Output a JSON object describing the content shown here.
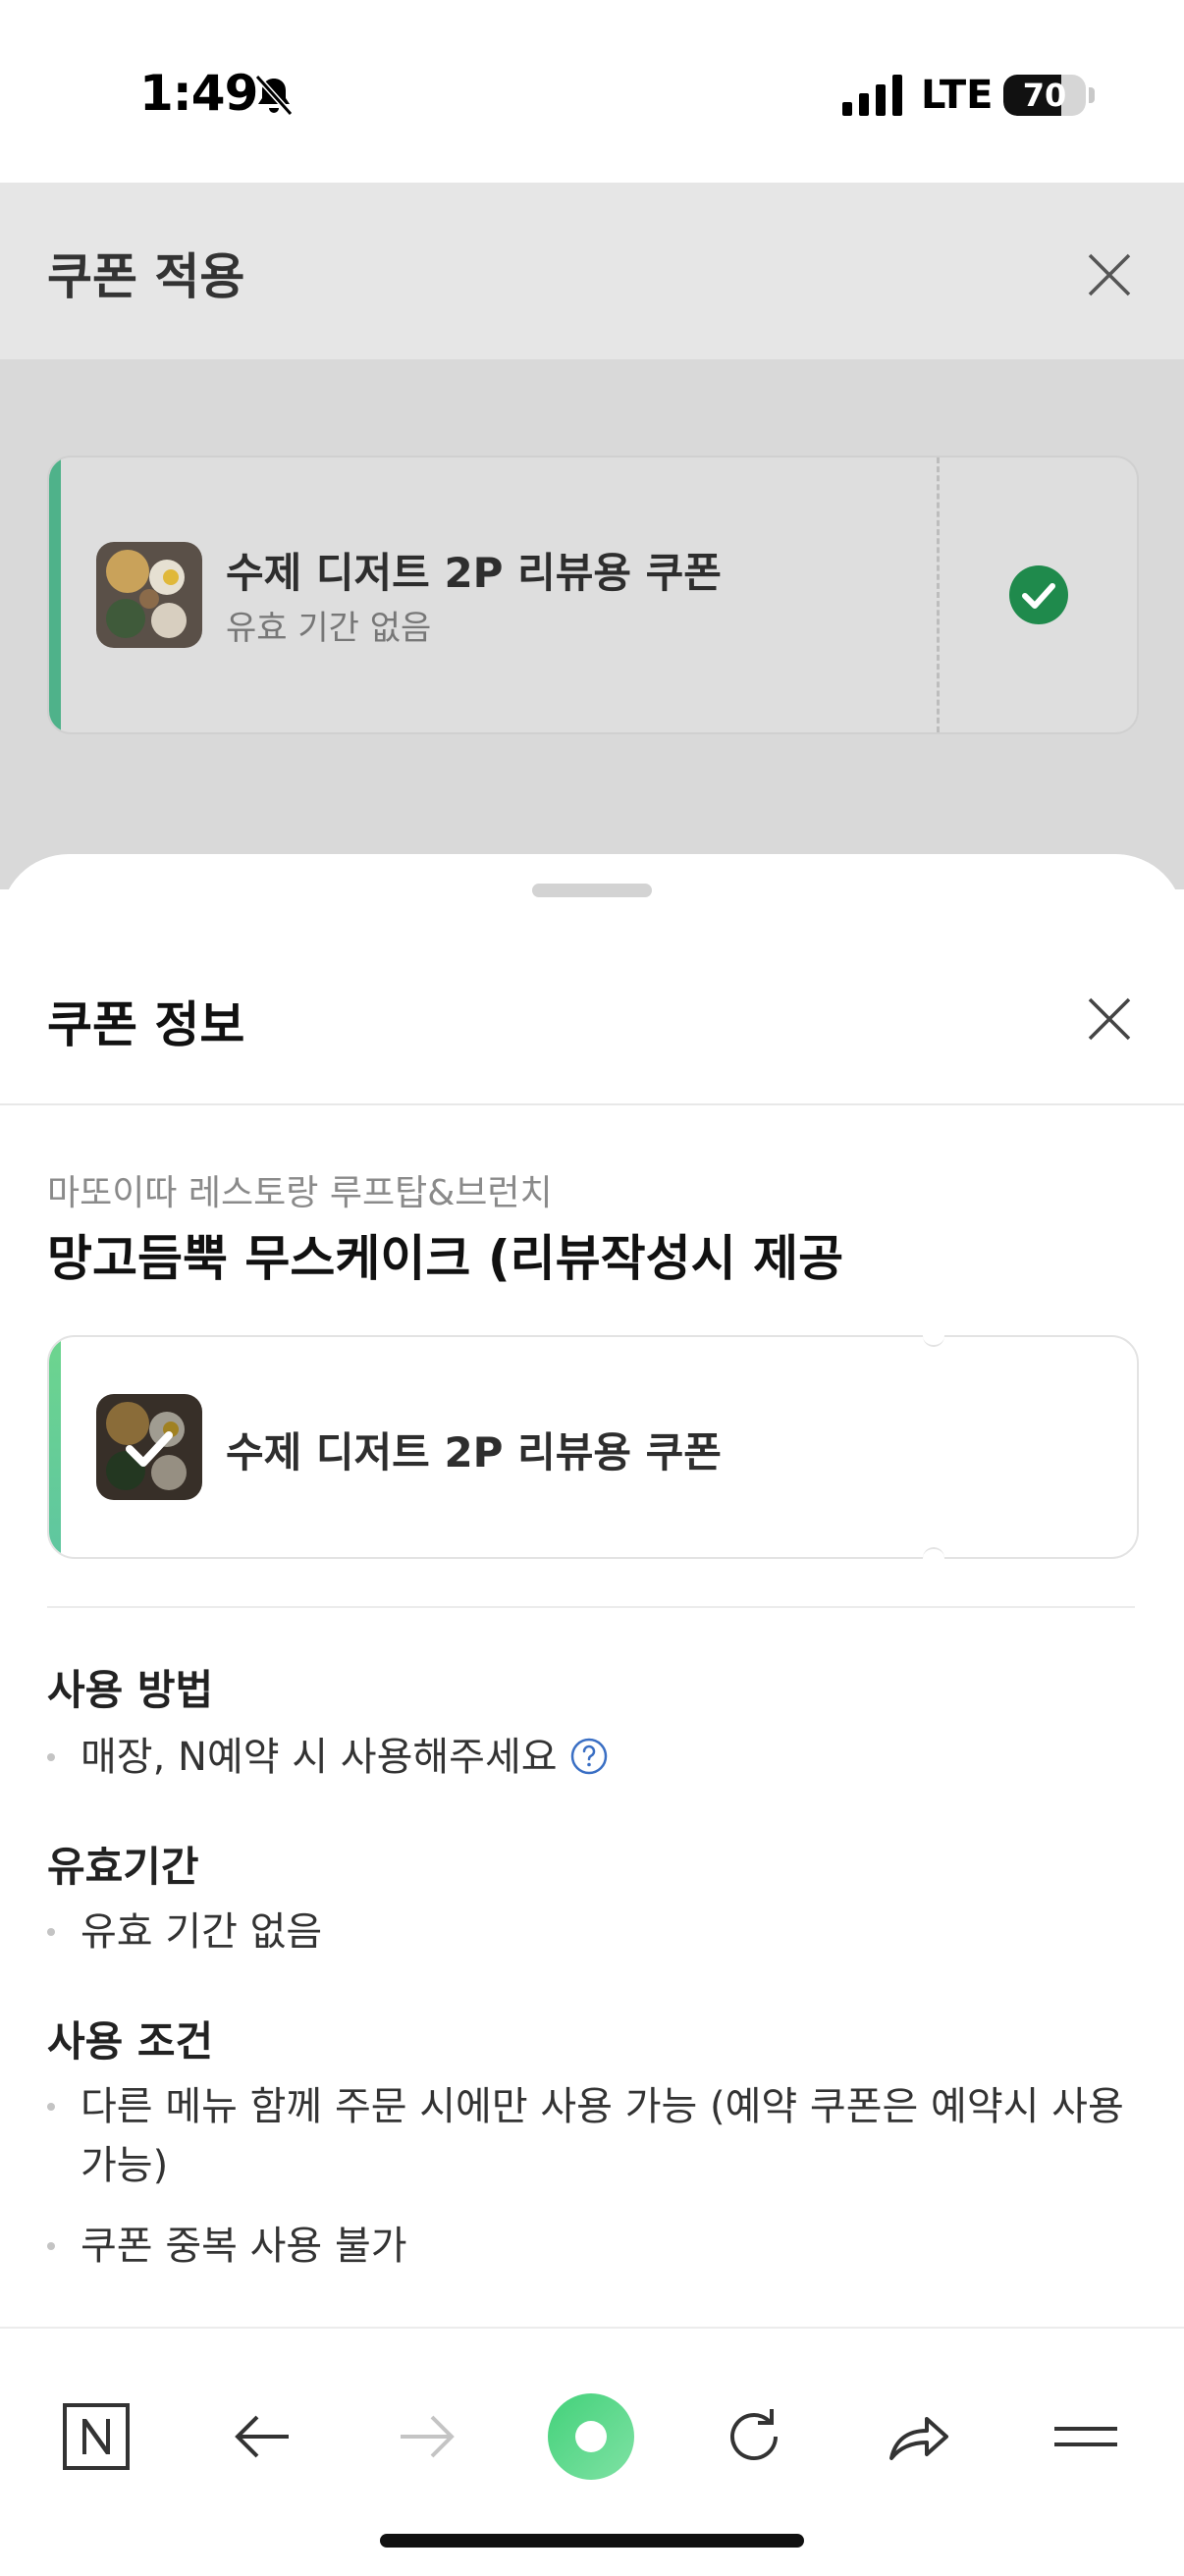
{
  "status_bar": {
    "time": "1:49",
    "network": "LTE",
    "battery": "70",
    "battery_level": 0.7,
    "icons": [
      "bell-slash-icon",
      "signal-bars-icon",
      "battery-icon"
    ]
  },
  "background_page": {
    "title": "쿠폰 적용",
    "coupon": {
      "name": "수제 디저트 2P 리뷰용 쿠폰",
      "validity": "유효 기간 없음",
      "selected": true
    }
  },
  "sheet": {
    "title": "쿠폰 정보",
    "store_name": "마또이따 레스토랑 루프탑&브런치",
    "menu_title": "망고듬뿍 무스케이크 (리뷰작성시 제공",
    "coupon_name": "수제 디저트 2P 리뷰용 쿠폰",
    "sections": [
      {
        "title": "사용 방법",
        "items": [
          "매장, N예약 시 사용해주세요"
        ]
      },
      {
        "title": "유효기간",
        "items": [
          "유효 기간 없음"
        ]
      },
      {
        "title": "사용 조건",
        "items": [
          "다른 메뉴 함께 주문 시에만 사용 가능 (예약 쿠폰은 예약시 사용 가능)",
          "쿠폰 중복 사용 불가"
        ]
      }
    ]
  },
  "toolbar": {
    "items": [
      "naver-home-icon",
      "back-arrow-icon",
      "forward-arrow-icon",
      "green-dot-icon",
      "reload-icon",
      "share-icon",
      "menu-icon"
    ]
  },
  "colors": {
    "accent_green": "#03c75a",
    "coupon_stripe": "#5fc6a0",
    "dim_overlay": "#d9d9d9"
  }
}
